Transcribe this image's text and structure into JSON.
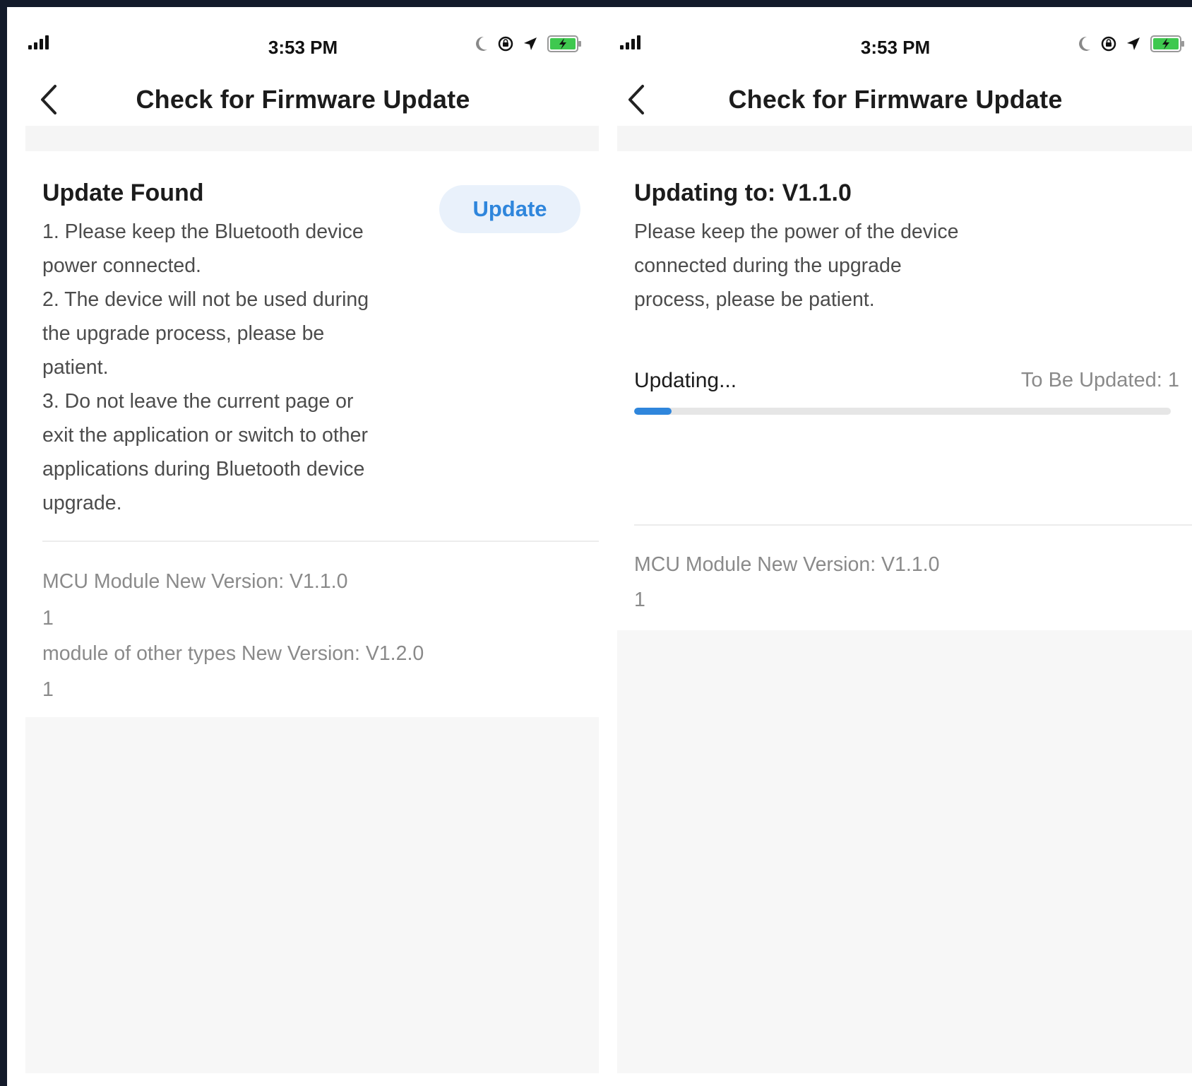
{
  "colors": {
    "accent": "#2f86dc",
    "background": "#131a2a",
    "panel_gray": "#f7f7f7"
  },
  "left": {
    "status_bar": {
      "time": "3:53 PM",
      "icons": [
        "signal-icon",
        "moon-icon",
        "orientation-lock-icon",
        "location-arrow-icon",
        "battery-charging-icon"
      ]
    },
    "nav": {
      "back_icon": "chevron-left-icon",
      "title": "Check for Firmware Update"
    },
    "card": {
      "title": "Update Found",
      "button_label": "Update",
      "lines": [
        "1. Please keep the Bluetooth device",
        "power connected.",
        "2. The device will not be used during",
        "the upgrade process, please be",
        "patient.",
        "3. Do not leave the current page or",
        "exit the application or switch to other",
        "applications during Bluetooth device",
        "upgrade."
      ]
    },
    "modules": [
      {
        "label": "MCU Module New Version: V1.1.0",
        "count": "1"
      },
      {
        "label": "module of other types New Version: V1.2.0",
        "count": "1"
      }
    ]
  },
  "right": {
    "status_bar": {
      "time": "3:53 PM",
      "icons": [
        "signal-icon",
        "moon-icon",
        "orientation-lock-icon",
        "location-arrow-icon",
        "battery-charging-icon"
      ]
    },
    "nav": {
      "back_icon": "chevron-left-icon",
      "title": "Check for Firmware Update"
    },
    "card": {
      "title": "Updating to: V1.1.0",
      "lines": [
        "Please keep the power of the device",
        "connected during the upgrade",
        "process, please be patient."
      ]
    },
    "progress": {
      "label": "Updating...",
      "remaining_label": "To Be Updated: 1",
      "fraction": 0.07
    },
    "modules": [
      {
        "label": "MCU Module New Version: V1.1.0",
        "count": "1"
      }
    ]
  }
}
